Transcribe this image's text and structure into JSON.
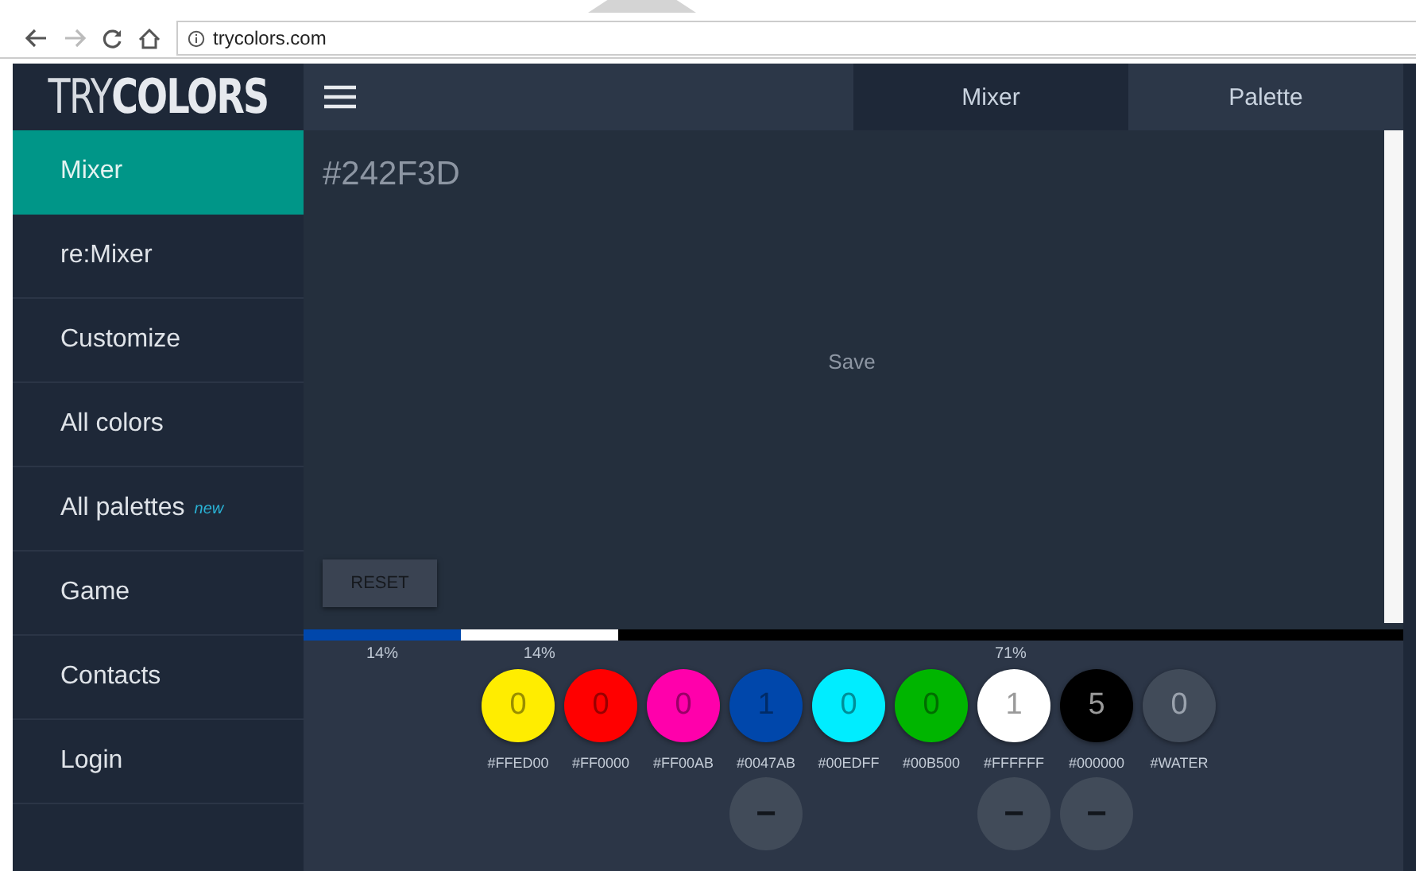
{
  "browser": {
    "url": "trycolors.com"
  },
  "logo": {
    "light": "TRY",
    "bold": "COLORS"
  },
  "sidebar": {
    "items": [
      {
        "label": "Mixer",
        "selected": true
      },
      {
        "label": "re:Mixer",
        "selected": false
      },
      {
        "label": "Customize",
        "selected": false
      },
      {
        "label": "All colors",
        "selected": false
      },
      {
        "label": "All palettes",
        "badge": "new",
        "selected": false
      },
      {
        "label": "Game",
        "selected": false
      },
      {
        "label": "Contacts",
        "selected": false
      },
      {
        "label": "Login",
        "selected": false
      }
    ]
  },
  "tabs": [
    {
      "label": "Mixer",
      "selected": true
    },
    {
      "label": "Palette",
      "selected": false
    }
  ],
  "canvas": {
    "color": "#242F3D",
    "hex": "#242F3D",
    "save": "Save",
    "reset": "RESET"
  },
  "mix_bar": [
    {
      "color": "#0047ab",
      "level": 0.143,
      "label": "14%"
    },
    {
      "color": "#ffffff",
      "level": 0.143,
      "label": "14%"
    },
    {
      "color": "#000000",
      "level": 0.714,
      "label": "71%"
    }
  ],
  "paints": [
    {
      "kind": "paint",
      "color": "#ffed00",
      "count": "0",
      "hex": "#FFED00",
      "minus": false
    },
    {
      "kind": "paint",
      "color": "#ff0000",
      "count": "0",
      "hex": "#FF0000",
      "minus": false
    },
    {
      "kind": "paint",
      "color": "#ff00ab",
      "count": "0",
      "hex": "#FF00AB",
      "minus": false
    },
    {
      "kind": "paint",
      "color": "#0047ab",
      "count": "1",
      "hex": "#0047AB",
      "minus": true
    },
    {
      "kind": "paint",
      "color": "#00edff",
      "count": "0",
      "hex": "#00EDFF",
      "minus": false
    },
    {
      "kind": "paint",
      "color": "#00b500",
      "count": "0",
      "hex": "#00B500",
      "minus": false
    },
    {
      "kind": "paint",
      "color": "#ffffff",
      "count": "1",
      "hex": "#FFFFFF",
      "minus": true
    },
    {
      "kind": "paint",
      "color": "#000000",
      "count": "5",
      "hex": "#000000",
      "minus": true
    },
    {
      "kind": "water",
      "count": "0",
      "hex": "#WATER",
      "minus": false
    }
  ],
  "minus_symbol": "−"
}
